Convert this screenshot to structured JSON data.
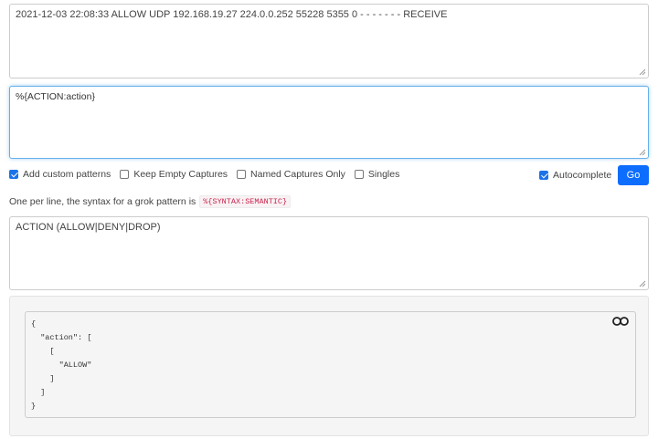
{
  "log_input": {
    "value": "2021-12-03 22:08:33 ALLOW UDP 192.168.19.27 224.0.0.252 55228 5355 0 - - - - - - - RECEIVE"
  },
  "pattern_input": {
    "value": "%{ACTION:action}"
  },
  "options": {
    "add_custom_patterns": {
      "label": "Add custom patterns",
      "checked": true
    },
    "keep_empty_captures": {
      "label": "Keep Empty Captures",
      "checked": false
    },
    "named_captures_only": {
      "label": "Named Captures Only",
      "checked": false
    },
    "singles": {
      "label": "Singles",
      "checked": false
    },
    "autocomplete": {
      "label": "Autocomplete",
      "checked": true
    }
  },
  "go_button": {
    "label": "Go"
  },
  "help": {
    "text": "One per line, the syntax for a grok pattern is",
    "syntax": "%{SYNTAX:SEMANTIC}"
  },
  "custom_patterns": {
    "value": "ACTION (ALLOW|DENY|DROP)"
  },
  "output": {
    "lines": [
      "{",
      "  \"action\": [",
      "    [",
      "      \"ALLOW\"",
      "    ]",
      "  ]",
      "}"
    ]
  },
  "icons": {
    "expand": "expand-icon",
    "resize": "resize-grip-icon"
  },
  "colors": {
    "go": "#0d6efd",
    "checkbox": "#1a73e8",
    "focus": "#66afe9"
  }
}
